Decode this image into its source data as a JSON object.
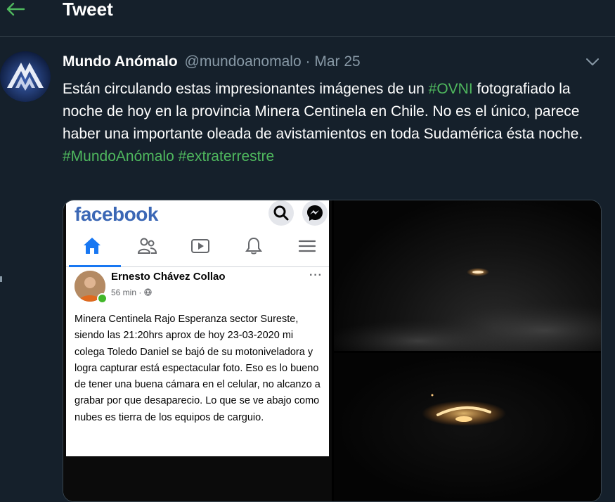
{
  "header": {
    "title": "Tweet",
    "back_icon": "arrow-left-icon"
  },
  "tweet": {
    "author_name": "Mundo Anómalo",
    "handle": "@mundoanomalo",
    "separator": "·",
    "date": "Mar 25",
    "text": {
      "line1_before": "Están circulando estas impresionantes imágenes de un ",
      "line1_hashtag": "#OVNI",
      "rest": "fotografiado la noche de hoy en la provincia Minera Centinela en Chile. No es el único, parece haber una importante oleada de avistamientos en toda Sudamérica ésta noche.",
      "hashtag1": "#MundoAnómalo",
      "hashtag2": "#extraterrestre"
    },
    "menu_icon": "chevron-down-icon"
  },
  "facebook_post": {
    "logo": "facebook",
    "author": "Ernesto Chávez Collao",
    "time": "56 min ·",
    "more": "···",
    "text": "Minera Centinela Rajo Esperanza sector Sureste, siendo las 21:20hrs aprox de hoy 23-03-2020 mi colega Toledo Daniel se bajó de su motoniveladora y logra capturar está espectacular foto. Eso es lo bueno de tener una buena cámara en el celular, no alcanzo a grabar por que desaparecio. Lo que se ve abajo como nubes es tierra de los equipos de carguio."
  },
  "colors": {
    "background": "#15202b",
    "hashtag": "#4fb85e",
    "muted": "#8899a6",
    "facebook_blue": "#3b67b5"
  }
}
